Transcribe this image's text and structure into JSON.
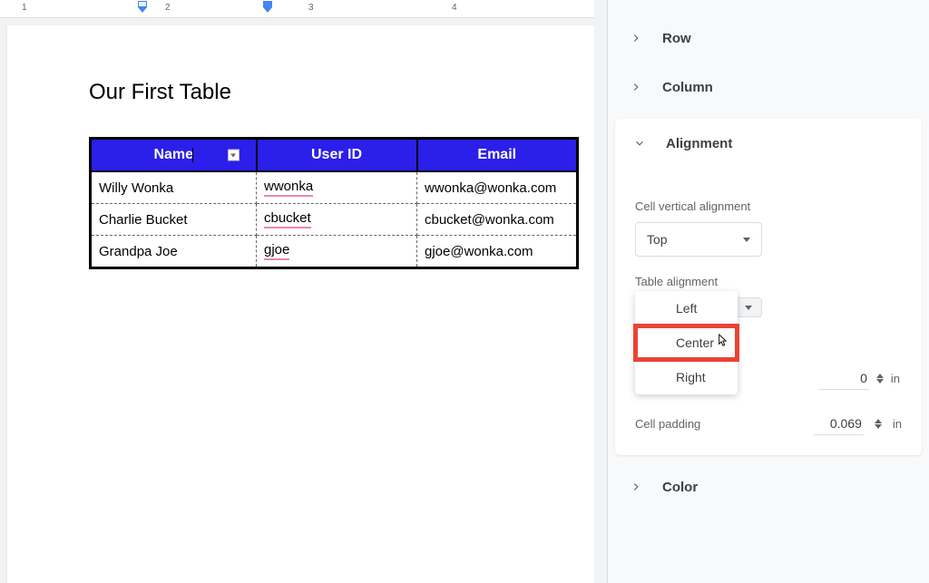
{
  "ruler": {
    "marks": [
      "1",
      "2",
      "3",
      "4"
    ]
  },
  "document": {
    "title": "Our First Table",
    "table": {
      "headers": [
        "Name",
        "User ID",
        "Email"
      ],
      "rows": [
        {
          "name": "Willy Wonka",
          "userid": "wwonka",
          "email": "wwonka@wonka.com"
        },
        {
          "name": "Charlie Bucket",
          "userid": "cbucket",
          "email": "cbucket@wonka.com"
        },
        {
          "name": "Grandpa Joe",
          "userid": "gjoe",
          "email": "gjoe@wonka.com"
        }
      ]
    }
  },
  "sidebar": {
    "sections": {
      "row": "Row",
      "column": "Column",
      "alignment": "Alignment",
      "color": "Color"
    },
    "alignment": {
      "vertical_label": "Cell vertical alignment",
      "vertical_value": "Top",
      "table_label": "Table alignment",
      "options": {
        "left": "Left",
        "center": "Center",
        "right": "Right"
      },
      "left_indent_value": "0",
      "left_indent_unit": "in",
      "padding_label": "Cell padding",
      "padding_value": "0.069",
      "padding_unit": "in"
    }
  }
}
